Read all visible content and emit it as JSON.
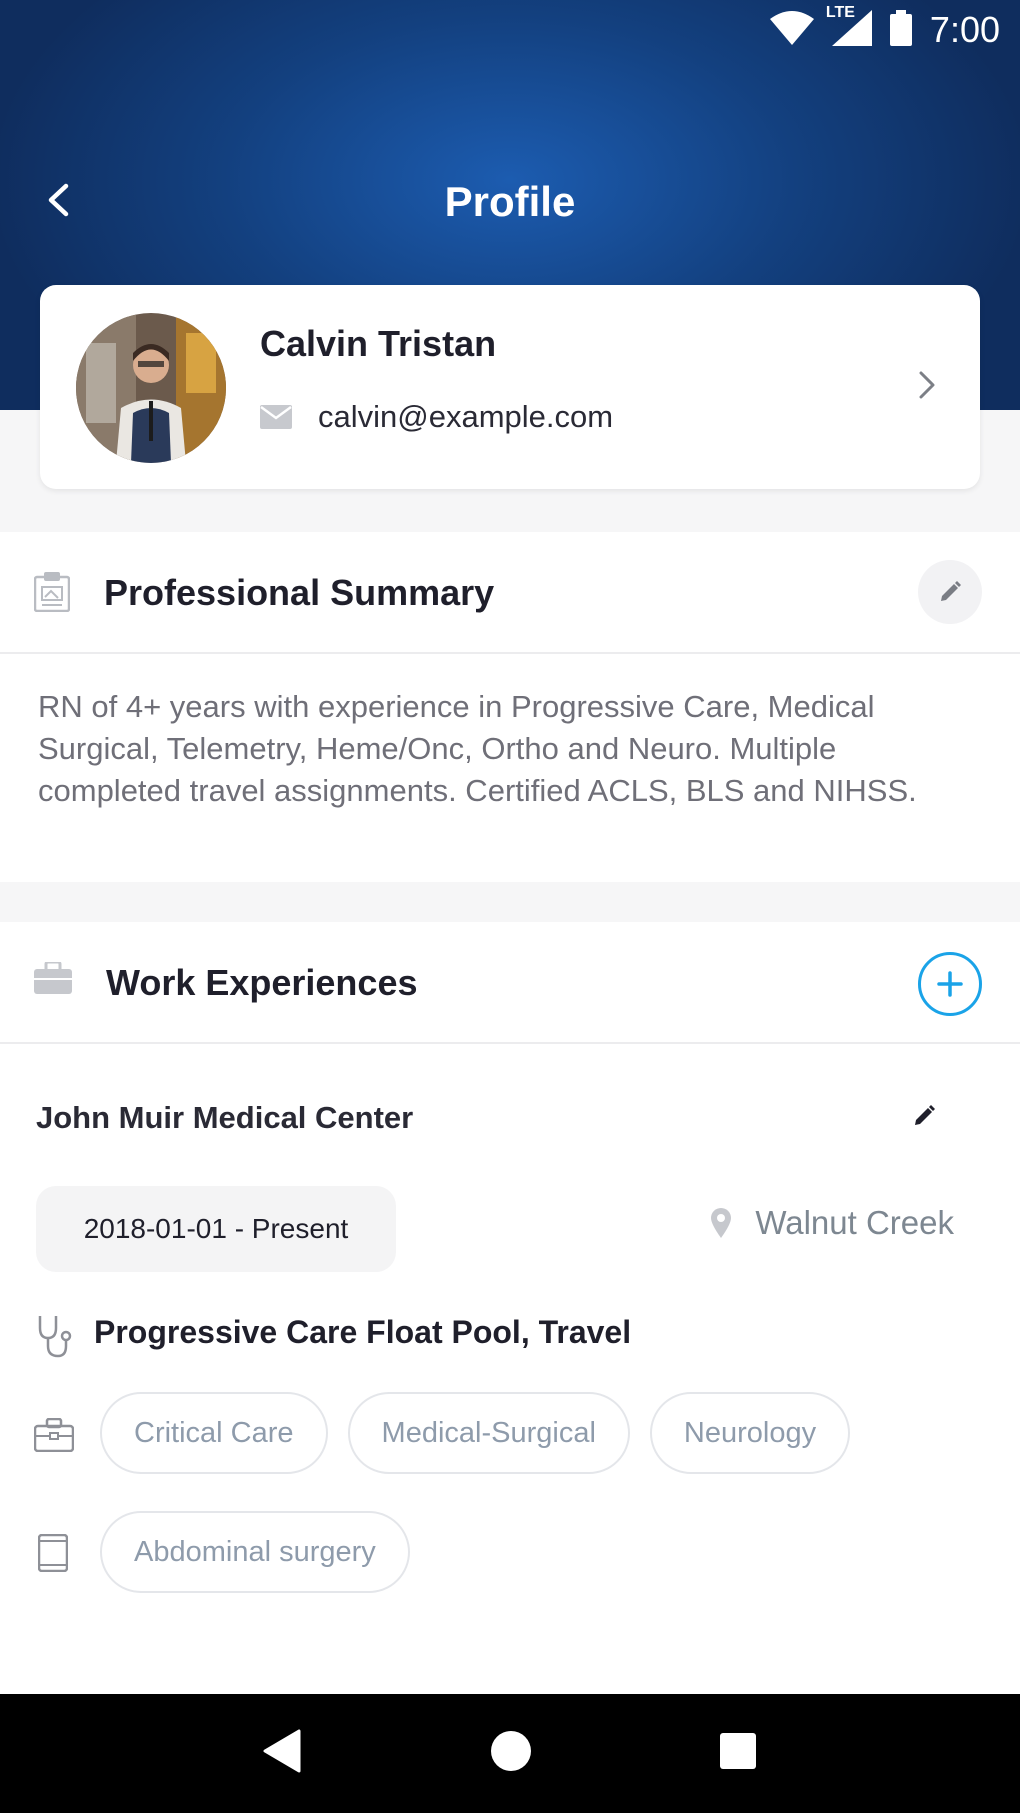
{
  "status_bar": {
    "time": "7:00",
    "network": "LTE"
  },
  "header": {
    "title": "Profile"
  },
  "profile": {
    "name": "Calvin Tristan",
    "email": "calvin@example.com"
  },
  "summary": {
    "title": "Professional Summary",
    "text": "RN of 4+ years with experience in Progressive Care, Medical Surgical, Telemetry, Heme/Onc, Ortho and Neuro. Multiple completed travel assignments. Certified ACLS, BLS and NIHSS."
  },
  "work": {
    "title": "Work Experiences",
    "entries": [
      {
        "company": "John Muir Medical Center",
        "dates": "2018-01-01 - Present",
        "location": "Walnut Creek",
        "role": "Progressive Care Float Pool, Travel",
        "specialties": [
          "Critical Care",
          "Medical-Surgical",
          "Neurology"
        ],
        "procedures": [
          "Abdominal surgery"
        ]
      }
    ]
  },
  "colors": {
    "header_dark": "#0f2d5e",
    "header_light": "#1c5cb0",
    "accent": "#1aa3e8",
    "tag_text": "#8e9bab"
  }
}
